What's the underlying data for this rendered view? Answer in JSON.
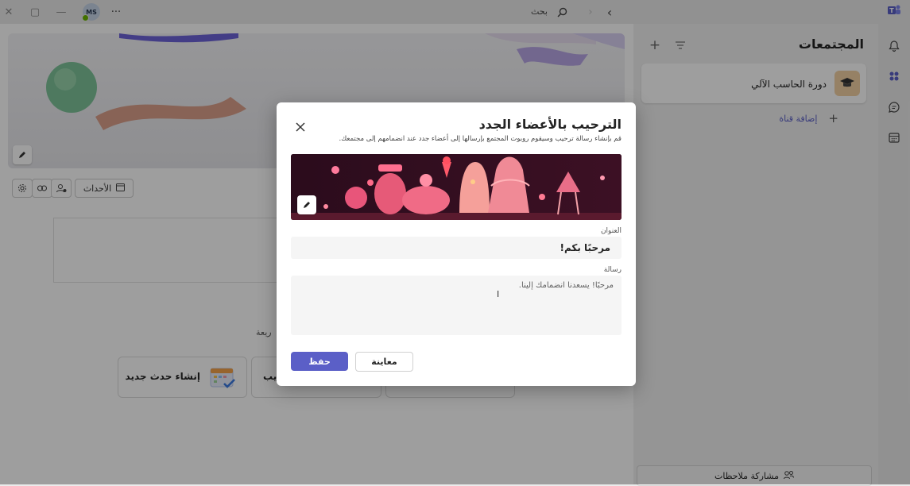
{
  "titlebar": {
    "search_label": "بحث",
    "avatar_initials": "MS",
    "more_label": "···"
  },
  "panel": {
    "title": "المجتمعات",
    "community_name": "دورة الحاسب الآلي",
    "add_channel_label": "إضافة قناة",
    "feedback_label": "مشاركة ملاحظات"
  },
  "main": {
    "events_label": "الأحداث",
    "quick_hint": "ريعة",
    "create_event_label": "إنشاء حدث جديد",
    "partial_card_label": "يب"
  },
  "dialog": {
    "title": "الترحيب بالأعضاء الجدد",
    "subtitle": "قم بإنشاء رسالة ترحيب وسيقوم روبوت المجتمع بإرسالها إلى أعضاء جدد عند انضمامهم إلى مجتمعك.",
    "title_field_label": "العنوان",
    "title_field_value": "مرحبًا بكم!",
    "message_field_label": "رسالة",
    "message_field_value": "مرحبًا! يسعدنا انضمامك إلينا.",
    "save_label": "حفظ",
    "preview_label": "معاينة"
  },
  "colors": {
    "accent": "#5b5fc7",
    "overlay": "rgba(0,0,0,0.38)"
  }
}
